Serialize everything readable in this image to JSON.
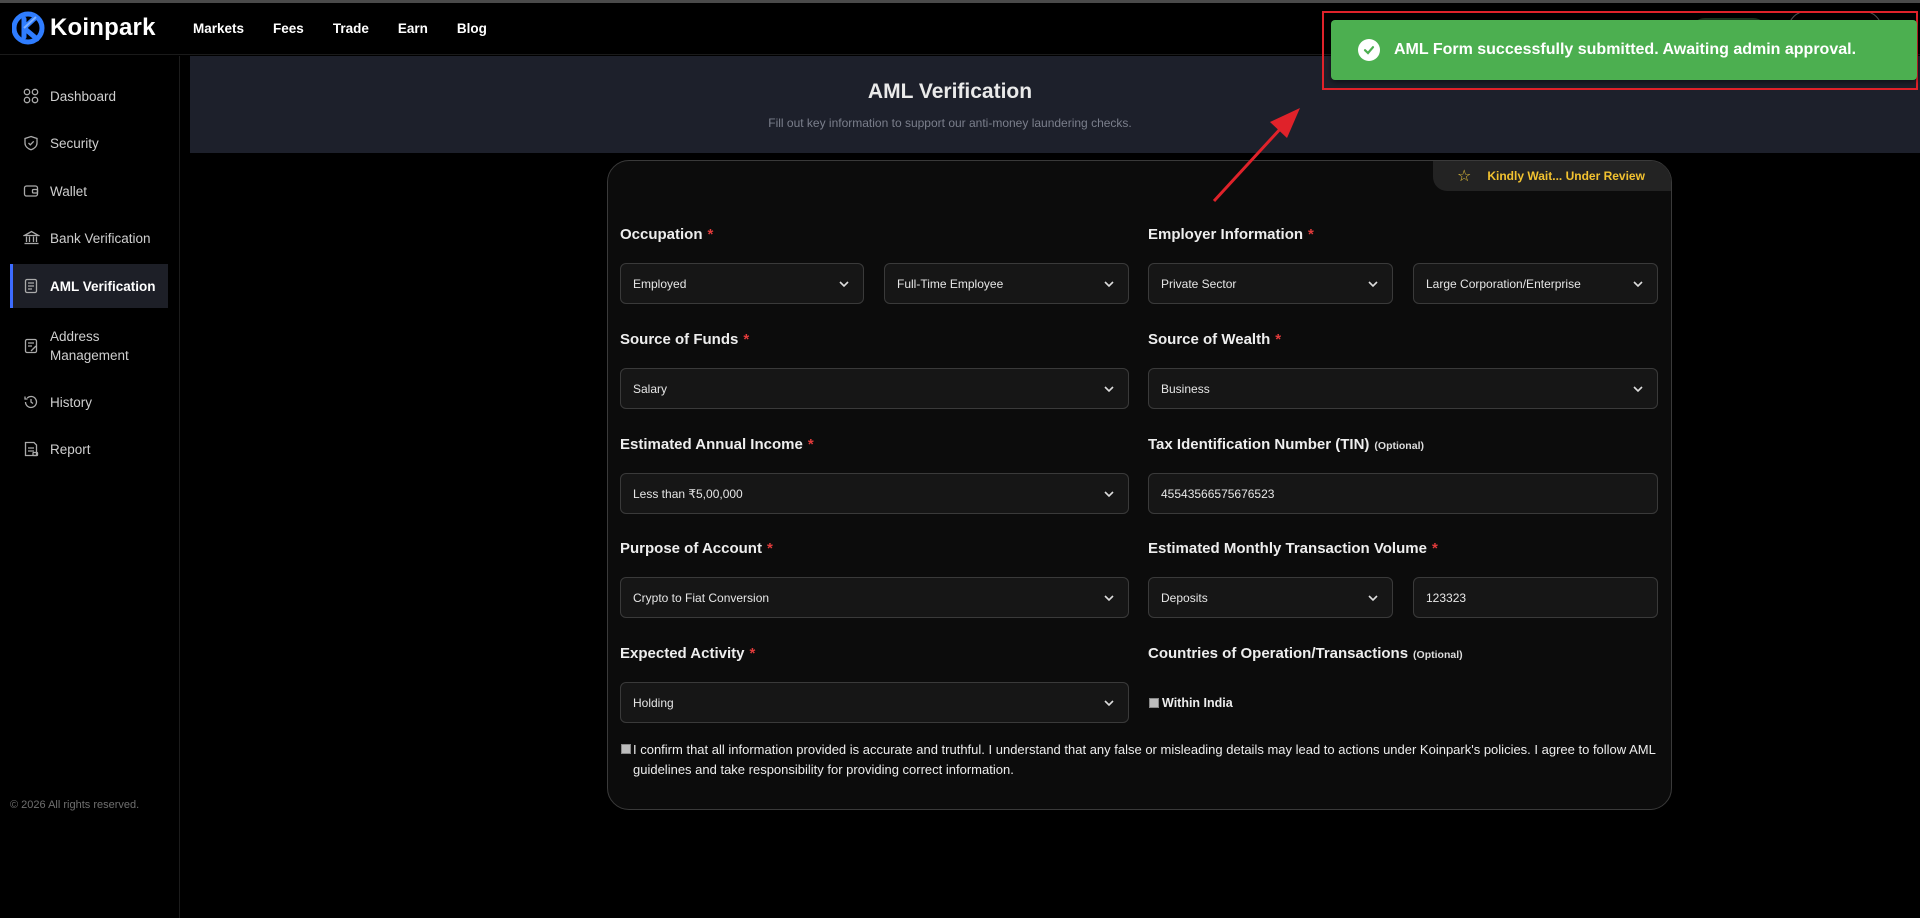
{
  "brand": {
    "name": "Koinpark"
  },
  "nav": [
    "Markets",
    "Fees",
    "Trade",
    "Earn",
    "Blog"
  ],
  "sidebar": {
    "items": [
      {
        "label": "Dashboard",
        "icon": "grid-icon"
      },
      {
        "label": "Security",
        "icon": "shield-icon"
      },
      {
        "label": "Wallet",
        "icon": "wallet-icon"
      },
      {
        "label": "Bank Verification",
        "icon": "bank-icon"
      },
      {
        "label": "AML Verification",
        "icon": "document-icon",
        "active": true
      },
      {
        "label": "Address Management",
        "icon": "address-book-icon"
      },
      {
        "label": "History",
        "icon": "history-icon"
      },
      {
        "label": "Report",
        "icon": "report-icon"
      }
    ],
    "copyright": "© 2026 All rights reserved."
  },
  "banner": {
    "title": "AML Verification",
    "subtitle": "Fill out key information to support our anti-money laundering checks."
  },
  "status_badge": "Kindly Wait... Under Review",
  "form": {
    "occupation": {
      "label": "Occupation",
      "value1": "Employed",
      "value2": "Full-Time Employee"
    },
    "employer": {
      "label": "Employer Information",
      "value1": "Private Sector",
      "value2": "Large Corporation/Enterprise"
    },
    "source_of_funds": {
      "label": "Source of Funds",
      "value": "Salary"
    },
    "source_of_wealth": {
      "label": "Source of Wealth",
      "value": "Business"
    },
    "annual_income": {
      "label": "Estimated Annual Income",
      "value": "Less than ₹5,00,000"
    },
    "tin": {
      "label": "Tax Identification Number (TIN)",
      "optional": "(Optional)",
      "value": "45543566575676523"
    },
    "purpose": {
      "label": "Purpose of Account",
      "value": "Crypto to Fiat Conversion"
    },
    "monthly_volume": {
      "label": "Estimated Monthly Transaction Volume",
      "type": "Deposits",
      "amount": "123323"
    },
    "expected_activity": {
      "label": "Expected Activity",
      "value": "Holding"
    },
    "countries": {
      "label": "Countries of Operation/Transactions",
      "optional": "(Optional)",
      "option": "Within India"
    },
    "confirm_text": "I confirm that all information provided is accurate and truthful. I understand that any false or misleading details may lead to actions under Koinpark's policies. I agree to follow AML guidelines and take responsibility for providing correct information."
  },
  "toast": {
    "message": "AML Form successfully submitted. Awaiting admin approval."
  },
  "colors": {
    "accent": "#3d6cff",
    "success": "#4caf50",
    "warning": "#f2c230",
    "required": "#e23b3b",
    "annotation": "#e0222a"
  }
}
